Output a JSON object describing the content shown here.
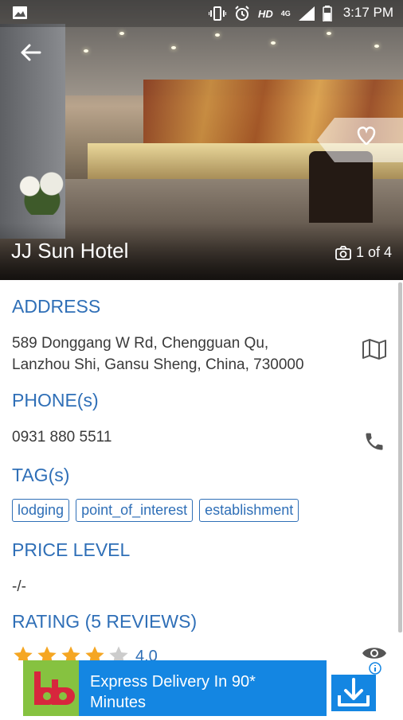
{
  "status_bar": {
    "network_label": "HD",
    "network_type": "4G",
    "time": "3:17 PM"
  },
  "hero": {
    "hotel_name": "JJ Sun Hotel",
    "photo_counter": "1 of 4"
  },
  "sections": {
    "address": {
      "heading": "ADDRESS",
      "line1": "589 Donggang W Rd, Chengguan Qu,",
      "line2": "Lanzhou Shi, Gansu Sheng, China, 730000"
    },
    "phone": {
      "heading": "PHONE(s)",
      "number": "0931 880 5511"
    },
    "tags": {
      "heading": "TAG(s)",
      "items": [
        "lodging",
        "point_of_interest",
        "establishment"
      ]
    },
    "price": {
      "heading": "PRICE LEVEL",
      "value": "-/-"
    },
    "rating": {
      "heading": "RATING (5 REVIEWS)",
      "value": "4.0",
      "stars_filled": 4,
      "stars_total": 5
    }
  },
  "ad": {
    "line1": "Express Delivery In 90*",
    "line2": "Minutes",
    "logo_text": "bb"
  },
  "colors": {
    "accent": "#2f6fb7",
    "star": "#f5a623",
    "star_empty": "#cccccc",
    "ad_blue": "#1486e2",
    "ad_green": "#86c240"
  }
}
